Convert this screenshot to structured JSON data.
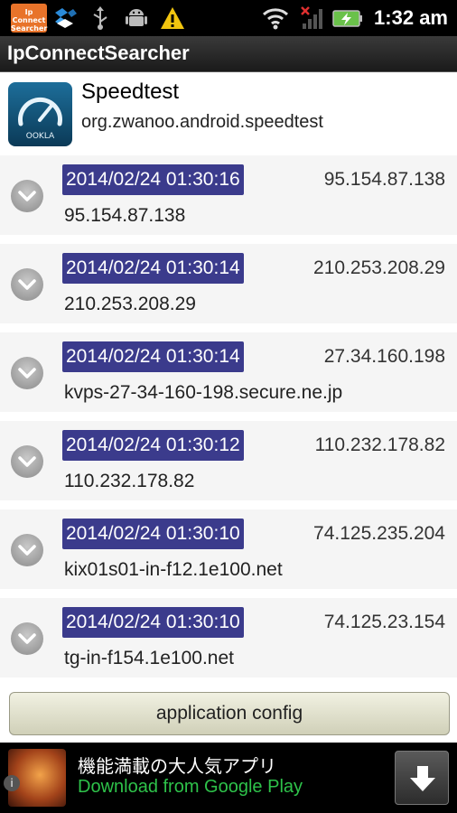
{
  "status_bar": {
    "app_notification_label": "IpConnectSearcher",
    "time": "1:32 am"
  },
  "titlebar": {
    "title": "IpConnectSearcher"
  },
  "app": {
    "name": "Speedtest",
    "package": "org.zwanoo.android.speedtest",
    "icon_text": "OOKLA"
  },
  "connections": [
    {
      "timestamp": "2014/02/24 01:30:16",
      "ip": "95.154.87.138",
      "host": "95.154.87.138"
    },
    {
      "timestamp": "2014/02/24 01:30:14",
      "ip": "210.253.208.29",
      "host": "210.253.208.29"
    },
    {
      "timestamp": "2014/02/24 01:30:14",
      "ip": "27.34.160.198",
      "host": "kvps-27-34-160-198.secure.ne.jp"
    },
    {
      "timestamp": "2014/02/24 01:30:12",
      "ip": "110.232.178.82",
      "host": "110.232.178.82"
    },
    {
      "timestamp": "2014/02/24 01:30:10",
      "ip": "74.125.235.204",
      "host": "kix01s01-in-f12.1e100.net"
    },
    {
      "timestamp": "2014/02/24 01:30:10",
      "ip": "74.125.23.154",
      "host": "tg-in-f154.1e100.net"
    }
  ],
  "config_button": {
    "label": "application config"
  },
  "ad": {
    "title": "機能満載の大人気アプリ",
    "subtitle": "Download from Google Play",
    "info": "i"
  },
  "colors": {
    "timestamp_bg": "#3b3b8c",
    "ad_subtitle": "#2ec24a",
    "notification_bg": "#e8732a"
  }
}
